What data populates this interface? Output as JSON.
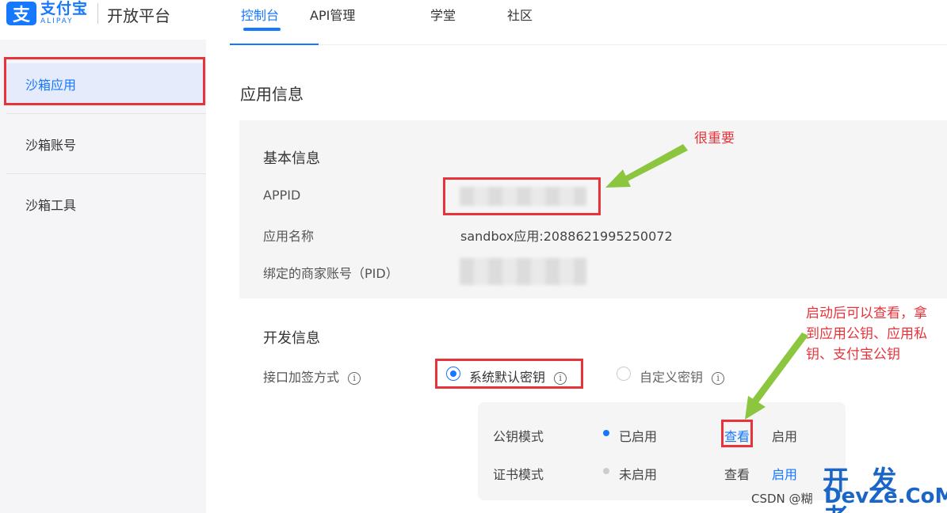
{
  "header": {
    "logo_mark": "支",
    "logo_cn": "支付宝",
    "logo_en": "ALIPAY",
    "platform": "开放平台",
    "tabs": [
      {
        "label": "控制台",
        "active": true
      },
      {
        "label": "API管理",
        "active": false
      },
      {
        "label": "学堂",
        "active": false
      },
      {
        "label": "社区",
        "active": false
      }
    ]
  },
  "sidebar": {
    "items": [
      {
        "label": "沙箱应用",
        "active": true
      },
      {
        "label": "沙箱账号",
        "active": false
      },
      {
        "label": "沙箱工具",
        "active": false
      }
    ]
  },
  "main": {
    "title": "应用信息",
    "basic": {
      "title": "基本信息",
      "appid_label": "APPID",
      "appname_label": "应用名称",
      "appname_value": "sandbox应用:2088621995250072",
      "pid_label": "绑定的商家账号（PID）"
    },
    "dev": {
      "title": "开发信息",
      "sign_label": "接口加签方式",
      "option_default": "系统默认密钥",
      "option_custom": "自定义密钥",
      "selected": "系统默认密钥",
      "modes": [
        {
          "name": "公钥模式",
          "status": "已启用",
          "view": "查看",
          "enable": "启用"
        },
        {
          "name": "证书模式",
          "status": "未启用",
          "view": "查看",
          "enable": "启用"
        }
      ]
    },
    "info_glyph": "i"
  },
  "annotations": {
    "important": "很重要",
    "note": [
      "启动后可以查看，拿",
      "到应用公钥、应用私",
      "钥、支付宝公钥"
    ]
  },
  "watermark": {
    "big": "开 发 者",
    "url": "DevZe.CoM",
    "csdn": "CSDN @糊"
  },
  "colors": {
    "brand": "#1677ff",
    "annotation_red": "#e8333b",
    "annotation_arrow": "#8cc63f"
  }
}
